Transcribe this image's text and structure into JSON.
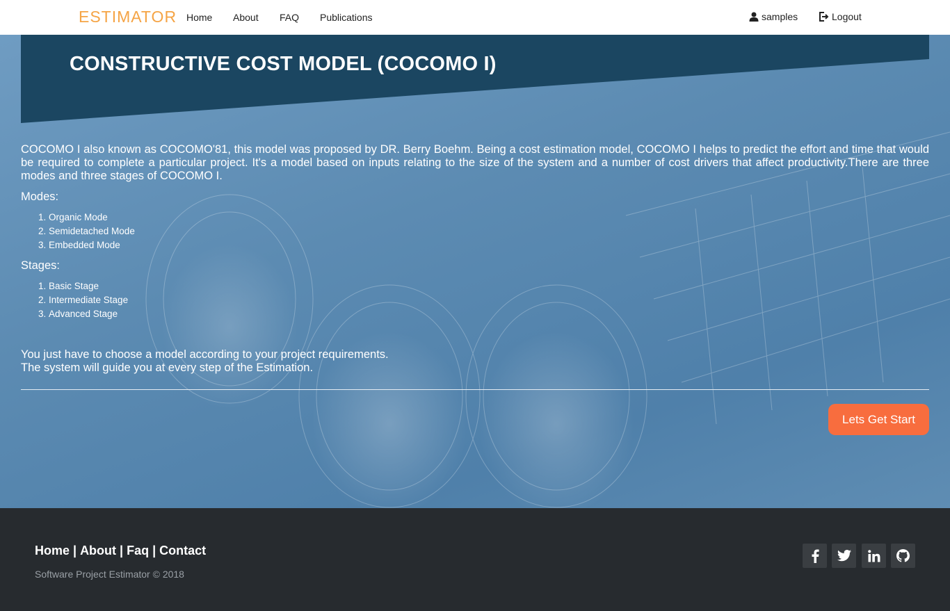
{
  "navbar": {
    "brand": "ESTIMATOR",
    "links": [
      "Home",
      "About",
      "FAQ",
      "Publications"
    ],
    "user_label": "samples",
    "logout_label": "Logout"
  },
  "hero": {
    "title": "CONSTRUCTIVE COST MODEL (COCOMO I)",
    "intro": "COCOMO I also known as COCOMO'81, this model was proposed by DR. Berry Boehm. Being a cost estimation model, COCOMO I helps to predict the effort and time that would be required to complete a particular project. It's a model based on inputs relating to the size of the system and a number of cost drivers that affect productivity.There are three modes and three stages of COCOMO I.",
    "modes_heading": "Modes:",
    "modes": [
      "Organic Mode",
      "Semidetached Mode",
      "Embedded Mode"
    ],
    "stages_heading": "Stages:",
    "stages": [
      "Basic Stage",
      "Intermediate Stage",
      "Advanced Stage"
    ],
    "closing_line1": "You just have to choose a model according to your project requirements.",
    "closing_line2": "The system will guide you at every step of the Estimation.",
    "cta_label": "Lets Get Start"
  },
  "footer": {
    "links": [
      "Home",
      "About",
      "Faq",
      "Contact"
    ],
    "separator": " | ",
    "copyright": "Software Project Estimator © 2018",
    "social_icons": [
      "facebook-icon",
      "twitter-icon",
      "linkedin-icon",
      "github-icon"
    ]
  },
  "colors": {
    "brand": "#f5a445",
    "banner": "#1b4661",
    "cta": "#f86d3e",
    "footer": "#272b2f"
  }
}
